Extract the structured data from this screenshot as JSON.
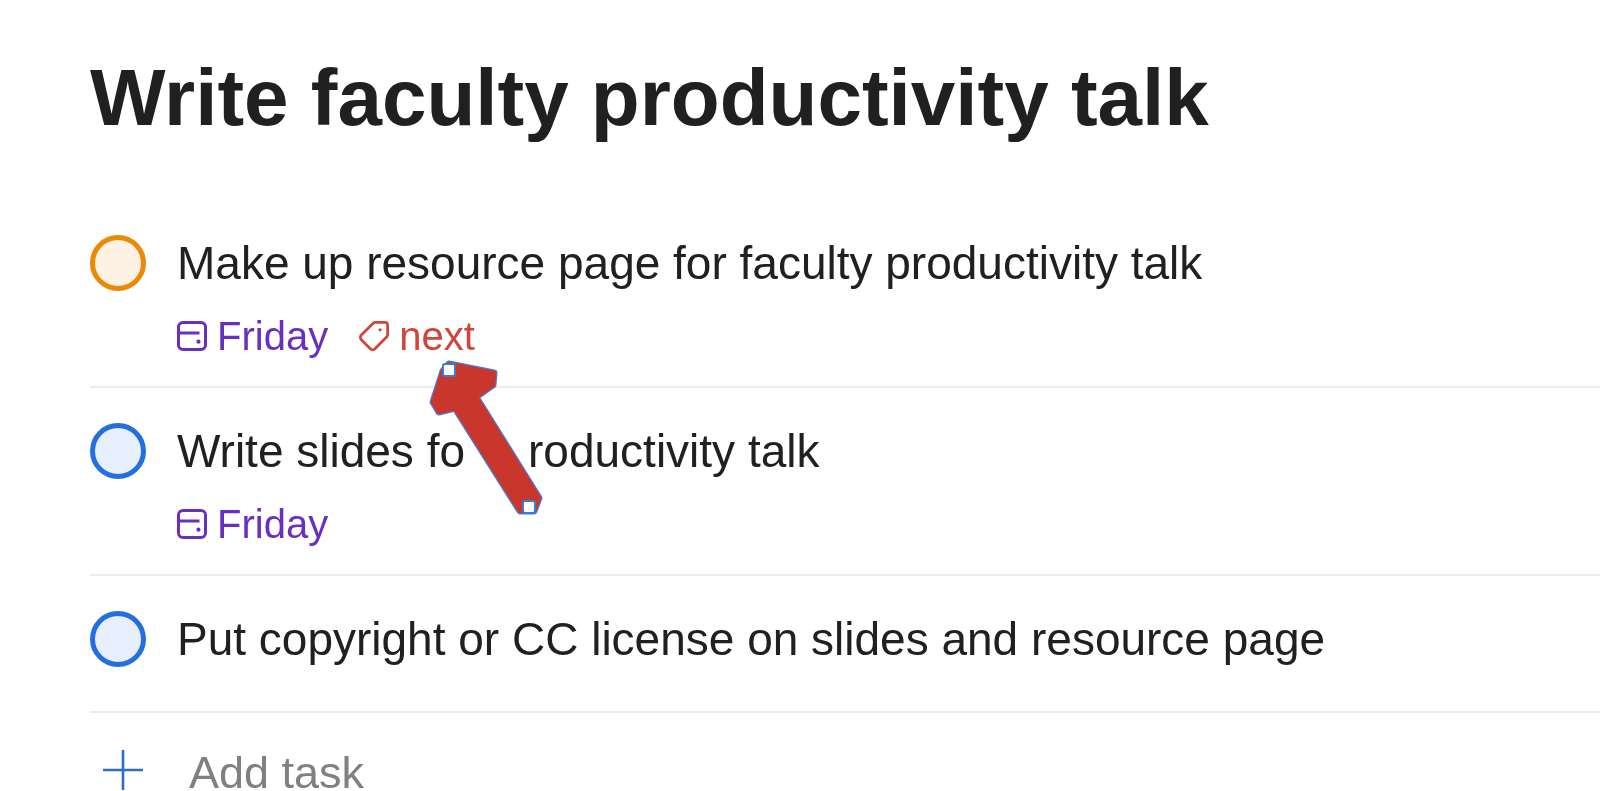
{
  "project": {
    "title": "Write faculty productivity talk"
  },
  "tasks": [
    {
      "title_parts": [
        "Make up resource page for faculty productivity talk"
      ],
      "checked": false,
      "color": "#eb8909",
      "meta": [
        {
          "kind": "date",
          "text": "Friday"
        },
        {
          "kind": "label",
          "text": "next"
        }
      ]
    },
    {
      "title_parts": [
        "Write slides fo",
        "roductivity talk"
      ],
      "checked": false,
      "color": "#246fe0",
      "meta": [
        {
          "kind": "date",
          "text": "Friday"
        }
      ]
    },
    {
      "title_parts": [
        "Put copyright or CC license on slides and resource page"
      ],
      "checked": false,
      "color": "#246fe0"
    }
  ],
  "add_task": {
    "label": "Add task"
  }
}
